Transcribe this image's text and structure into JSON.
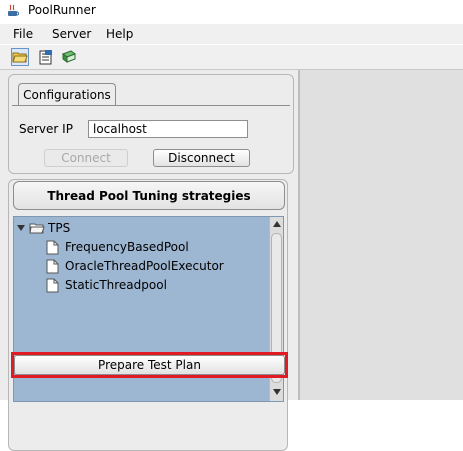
{
  "app": {
    "title": "PoolRunner",
    "icon": "java-coffee-cup-icon"
  },
  "menu": {
    "items": [
      "File",
      "Server",
      "Help"
    ]
  },
  "toolbar": {
    "buttons": [
      {
        "icon": "open-folder-icon",
        "active": true
      },
      {
        "icon": "document-icon",
        "active": false
      },
      {
        "icon": "book-icon",
        "active": false
      }
    ]
  },
  "configurations": {
    "tab_label": "Configurations",
    "server_ip_label": "Server IP",
    "server_ip_value": "localhost",
    "connect_label": "Connect",
    "connect_enabled": false,
    "disconnect_label": "Disconnect"
  },
  "strategies": {
    "header": "Thread Pool Tuning strategies",
    "tree": {
      "root": "TPS",
      "children": [
        "FrequencyBasedPool",
        "OracleThreadPoolExecutor",
        "StaticThreadpool"
      ]
    },
    "prepare_label": "Prepare Test Plan"
  },
  "colors": {
    "tree_background": "#9db6d2",
    "highlight_outline": "#e01b24"
  }
}
